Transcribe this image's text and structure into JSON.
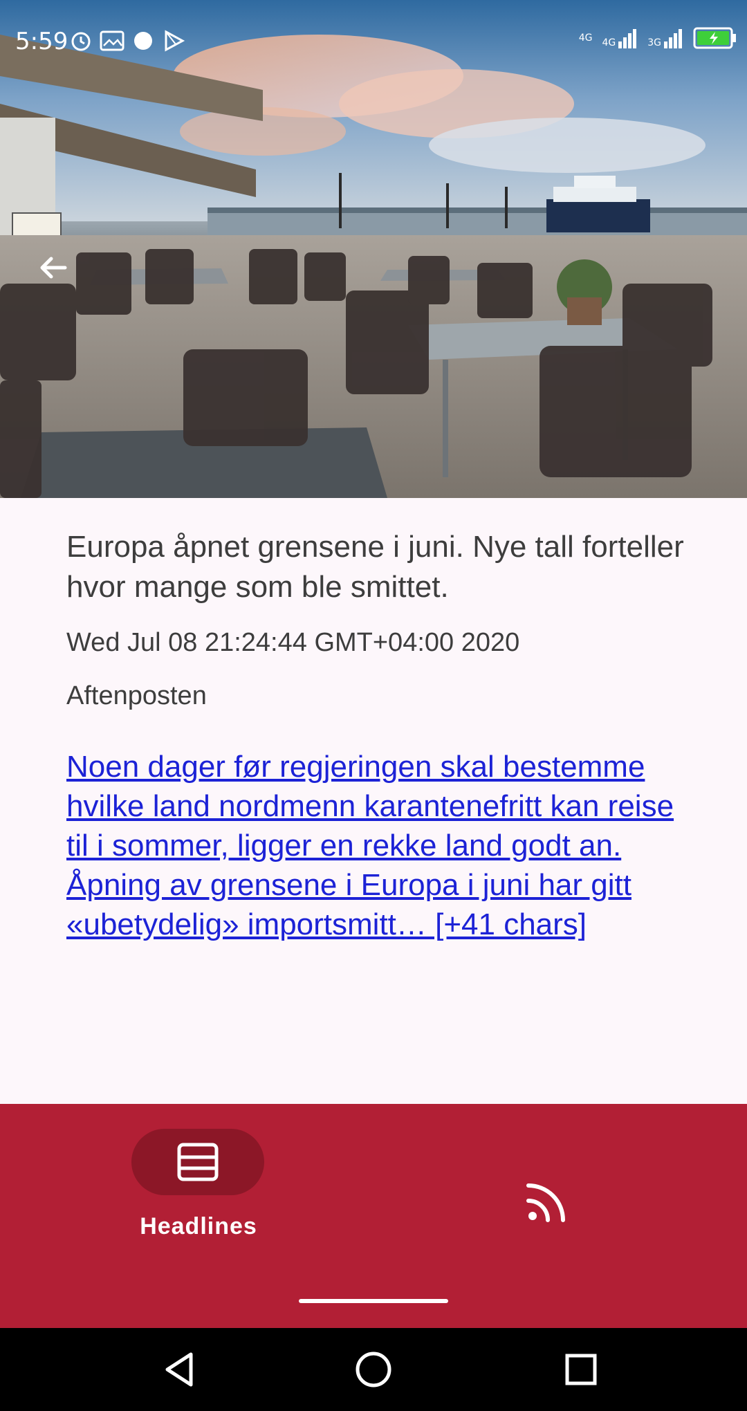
{
  "status_bar": {
    "time": "5:59",
    "left_icons": [
      "alarm-icon",
      "image-icon",
      "circle-icon",
      "play-store-icon"
    ],
    "network_labels": [
      "4G",
      "4G",
      "3G"
    ],
    "battery": "charging"
  },
  "hero": {
    "image_description_icon": "cafe-harbor-photo",
    "back_icon": "arrow-left-icon"
  },
  "article": {
    "title": "Europa åpnet grensene i juni. Nye tall forteller hvor mange som ble smittet.",
    "date": "Wed Jul 08 21:24:44 GMT+04:00 2020",
    "source": "Aftenposten",
    "description": "Noen dager før regjeringen skal bestemme hvilke land nordmenn karantenefritt kan reise til i sommer, ligger en rekke land godt an. Åpning av grensene i Europa i juni har gitt «ubetydelig» importsmitt… [+41 chars]"
  },
  "bottom_nav": {
    "items": [
      {
        "label": "Headlines",
        "icon": "headlines-icon",
        "selected": true
      },
      {
        "label": "",
        "icon": "rss-feed-icon",
        "selected": false
      }
    ],
    "color": "#b21f35",
    "selected_pill_color": "#8c1727"
  },
  "system_nav": {
    "buttons": [
      "back-triangle-icon",
      "home-circle-icon",
      "recents-square-icon"
    ]
  }
}
